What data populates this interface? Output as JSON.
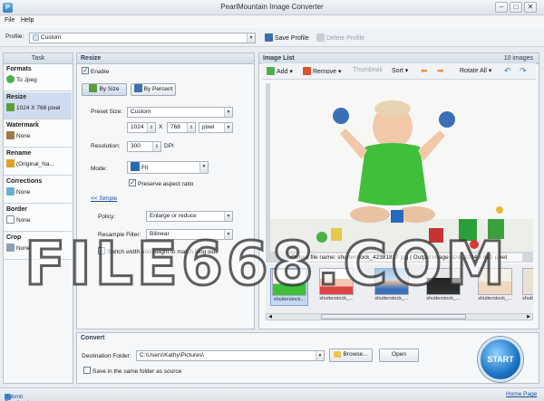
{
  "window": {
    "title": "PearlMountain Image Converter"
  },
  "menu": {
    "file": "File",
    "help": "Help"
  },
  "profile": {
    "label": "Profile:",
    "value": "Custom",
    "save": "Save Profile",
    "delete": "Delete Profile"
  },
  "task": {
    "header": "Task",
    "groups": [
      {
        "name": "Formats",
        "value": "To Jpeg"
      },
      {
        "name": "Resize",
        "value": "1024 X 768 pixel"
      },
      {
        "name": "Watermark",
        "value": "None"
      },
      {
        "name": "Rename",
        "value": "(Original_Na..."
      },
      {
        "name": "Corrections",
        "value": "None"
      },
      {
        "name": "Border",
        "value": "None"
      },
      {
        "name": "Crop",
        "value": "None"
      }
    ]
  },
  "resize": {
    "header": "Resize",
    "enable": "Enable",
    "by_size": "By Size",
    "by_percent": "By Percent",
    "preset_label": "Preset Size:",
    "preset_value": "Custom",
    "width": "1024",
    "x": "X",
    "height": "768",
    "unit": "pixel",
    "resolution_label": "Resolution:",
    "resolution": "300",
    "dpi": "DPI",
    "mode_label": "Mode:",
    "mode": "Fit",
    "preserve": "Preserve aspect ratio",
    "simple": "<< Simple",
    "policy_label": "Policy:",
    "policy": "Enlarge or reduce",
    "filter_label": "Resample Filter:",
    "filter": "Bilinear",
    "switch": "Switch width and height to match long side"
  },
  "image_list": {
    "header": "Image List",
    "count": "10 images",
    "add": "Add",
    "remove": "Remove",
    "thumbnail": "Thumbnail",
    "sort": "Sort",
    "rotate_all": "Rotate All",
    "output_info": "Output file name: shutterstock_42381817.jpg | Output image size: 1024 x 682 pixel",
    "thumbs": [
      "shutterstock...",
      "shutterstock_...",
      "shutterstock_...",
      "shutterstock_...",
      "shutterstock_...",
      "shutt"
    ]
  },
  "convert": {
    "header": "Convert",
    "dest_label": "Destination Folder:",
    "dest_value": "C:\\Users\\Kathy\\Pictures\\",
    "browse": "Browse...",
    "open": "Open",
    "same_folder": "Save in the same folder as source",
    "start": "START"
  },
  "watermark": "FILE668.COM",
  "status": {
    "feedback": "Submit Feedback",
    "home": "Home Page"
  },
  "colors": {
    "accent": "#2f7fc4",
    "selected": "#cfdcef",
    "start": "#1c74c5",
    "shirt": "#3fbf3a"
  }
}
